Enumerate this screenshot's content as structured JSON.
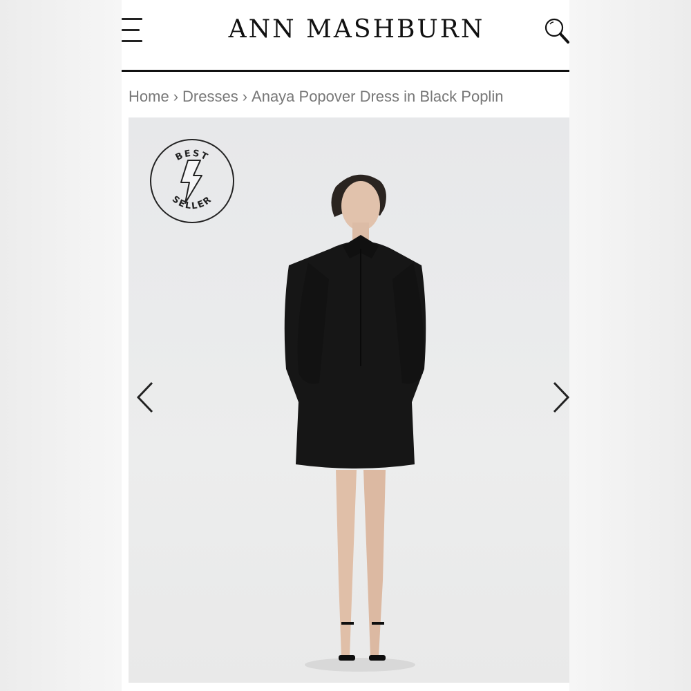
{
  "header": {
    "logo_text": "ANN MASHBURN",
    "menu_icon": "hamburger-icon",
    "search_icon": "search-icon"
  },
  "breadcrumb": {
    "items": [
      "Home",
      "Dresses",
      "Anaya Popover Dress in Black Poplin"
    ],
    "separator": "›"
  },
  "gallery": {
    "badge": {
      "top_text": "BEST",
      "bottom_text": "SELLER",
      "icon": "lightning-bolt-icon"
    },
    "prev_icon": "chevron-left-icon",
    "next_icon": "chevron-right-icon",
    "image_subject": "model-wearing-black-dress"
  },
  "colors": {
    "text_dark": "#111111",
    "breadcrumb_gray": "#777777",
    "photo_background": "#e8e9ea",
    "dress": "#151515"
  }
}
